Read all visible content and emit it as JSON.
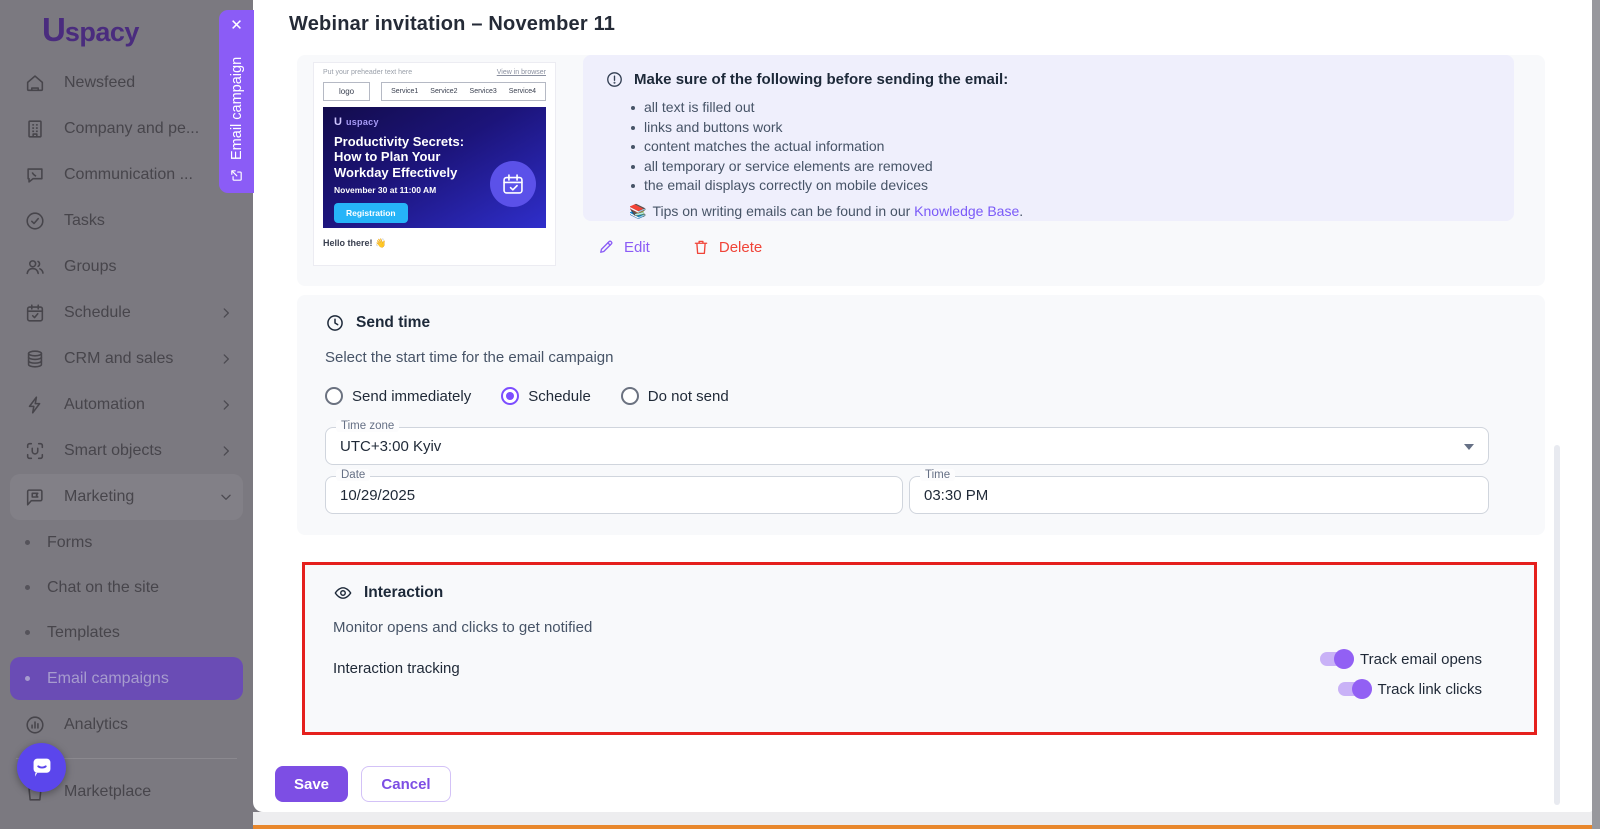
{
  "colors": {
    "accent_purple": "#8b5cf6",
    "save_purple": "#7d4ee4",
    "toggle_purple": "#9260f4",
    "link_purple": "#7a5af8",
    "delete_red": "#f04438",
    "highlight_red": "#e5201d",
    "cta_blue": "#26b4f8",
    "banner_gradient_start": "#130c4c",
    "banner_gradient_end": "#2f2ecb",
    "info_panel_bg": "#efeffc",
    "section_bg": "#f8f9fb",
    "orange_strip": "#e8872c"
  },
  "sidebar": {
    "brand_mark": "U",
    "brand_text": "spacy",
    "items": [
      {
        "label": "Newsfeed",
        "icon": "home"
      },
      {
        "label": "Company and pe...",
        "icon": "building",
        "chevron": "right"
      },
      {
        "label": "Communication ...",
        "icon": "chat",
        "chevron": "right"
      },
      {
        "label": "Tasks",
        "icon": "task-check"
      },
      {
        "label": "Groups",
        "icon": "people"
      },
      {
        "label": "Schedule",
        "icon": "calendar",
        "chevron": "right"
      },
      {
        "label": "CRM and sales",
        "icon": "database",
        "chevron": "right"
      },
      {
        "label": "Automation",
        "icon": "bolt",
        "chevron": "right"
      },
      {
        "label": "Smart objects",
        "icon": "smart-object",
        "chevron": "right"
      },
      {
        "label": "Marketing",
        "icon": "marketing",
        "chevron": "down",
        "expanded": true
      }
    ],
    "marketing_subitems": [
      {
        "label": "Forms",
        "active": false
      },
      {
        "label": "Chat on the site",
        "active": false
      },
      {
        "label": "Templates",
        "active": false
      },
      {
        "label": "Email campaigns",
        "active": true
      }
    ],
    "bottom_items": [
      {
        "label": "Analytics",
        "icon": "analytics"
      },
      {
        "label": "Marketplace",
        "icon": "marketplace"
      }
    ]
  },
  "side_tab": {
    "label": "Email campaign",
    "close_glyph": "✕"
  },
  "modal": {
    "title": "Webinar invitation – November 11",
    "preview": {
      "preheader": "Put your preheader text here",
      "view_in_browser": "View in browser",
      "logo_box": "logo",
      "nav_links": [
        "Service1",
        "Service2",
        "Service3",
        "Service4"
      ],
      "banner": {
        "brand_mark": "U",
        "brand_text": "uspacy",
        "headline": "Productivity Secrets:\nHow to Plan Your\nWorkday Effectively",
        "datetime": "November 30 at 11:00 AM",
        "cta": "Registration"
      },
      "greeting": "Hello there! 👋"
    },
    "checklist": {
      "title": "Make sure of the following before sending the email:",
      "items": [
        "all text is filled out",
        "links and buttons work",
        "content matches the actual information",
        "all temporary or service elements are removed",
        "the email displays correctly on mobile devices"
      ],
      "tip_emoji": "📚",
      "tip_prefix": "Tips on writing emails can be found in our",
      "tip_link": "Knowledge Base",
      "tip_suffix": "."
    },
    "actions": {
      "edit": "Edit",
      "delete": "Delete"
    },
    "send_time": {
      "title": "Send time",
      "subtitle": "Select the start time for the email campaign",
      "options": [
        {
          "label": "Send immediately",
          "selected": false
        },
        {
          "label": "Schedule",
          "selected": true
        },
        {
          "label": "Do not send",
          "selected": false
        }
      ],
      "timezone": {
        "label": "Time zone",
        "value": "UTC+3:00 Kyiv"
      },
      "date": {
        "label": "Date",
        "value": "10/29/2025"
      },
      "time": {
        "label": "Time",
        "value": "03:30 PM"
      }
    },
    "interaction": {
      "title": "Interaction",
      "subtitle": "Monitor opens and clicks to get notified",
      "row_label": "Interaction tracking",
      "toggles": [
        {
          "label": "Track email opens",
          "on": true
        },
        {
          "label": "Track link clicks",
          "on": true
        }
      ]
    },
    "footer": {
      "save": "Save",
      "cancel": "Cancel"
    }
  }
}
